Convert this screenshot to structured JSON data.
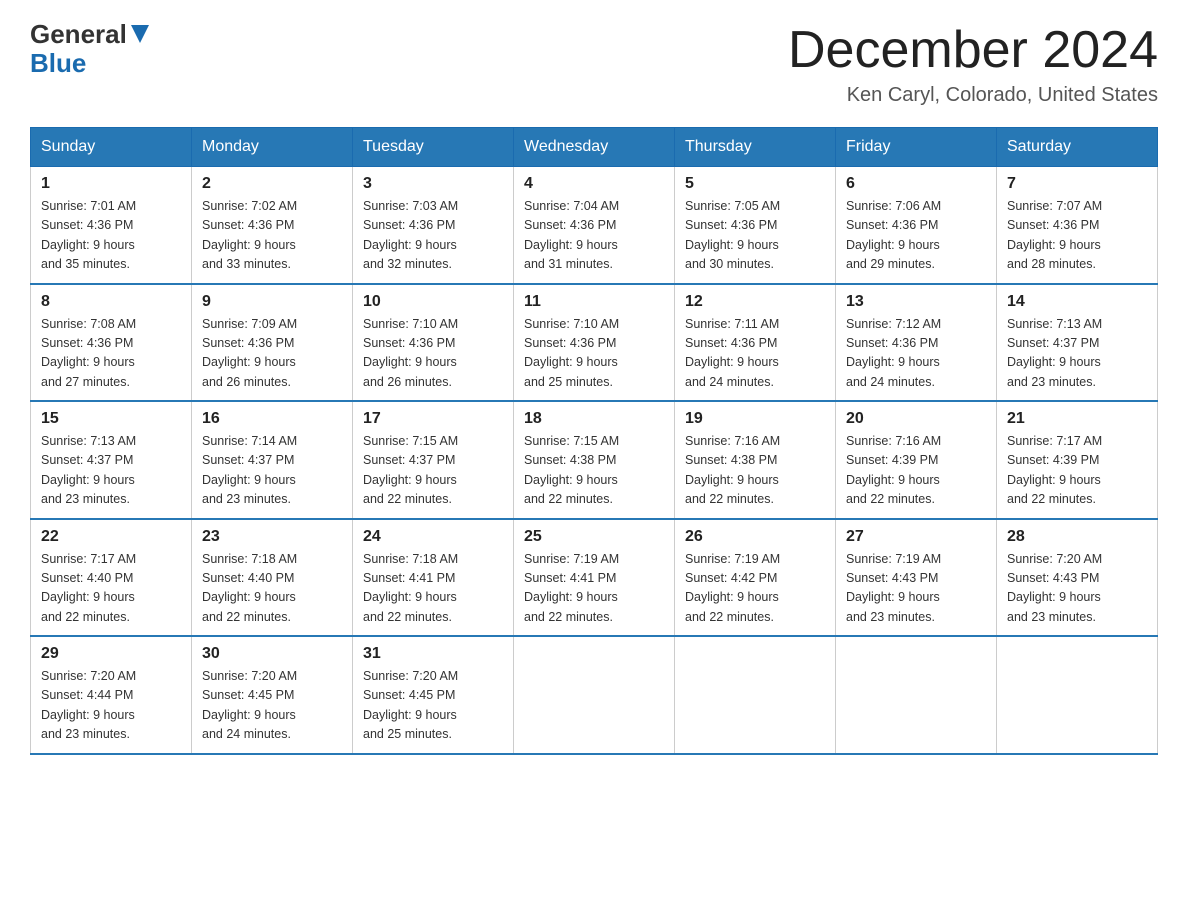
{
  "logo": {
    "line1": "General",
    "line2": "Blue"
  },
  "title": "December 2024",
  "location": "Ken Caryl, Colorado, United States",
  "days_of_week": [
    "Sunday",
    "Monday",
    "Tuesday",
    "Wednesday",
    "Thursday",
    "Friday",
    "Saturday"
  ],
  "weeks": [
    [
      {
        "day": "1",
        "sunrise": "7:01 AM",
        "sunset": "4:36 PM",
        "daylight": "9 hours and 35 minutes."
      },
      {
        "day": "2",
        "sunrise": "7:02 AM",
        "sunset": "4:36 PM",
        "daylight": "9 hours and 33 minutes."
      },
      {
        "day": "3",
        "sunrise": "7:03 AM",
        "sunset": "4:36 PM",
        "daylight": "9 hours and 32 minutes."
      },
      {
        "day": "4",
        "sunrise": "7:04 AM",
        "sunset": "4:36 PM",
        "daylight": "9 hours and 31 minutes."
      },
      {
        "day": "5",
        "sunrise": "7:05 AM",
        "sunset": "4:36 PM",
        "daylight": "9 hours and 30 minutes."
      },
      {
        "day": "6",
        "sunrise": "7:06 AM",
        "sunset": "4:36 PM",
        "daylight": "9 hours and 29 minutes."
      },
      {
        "day": "7",
        "sunrise": "7:07 AM",
        "sunset": "4:36 PM",
        "daylight": "9 hours and 28 minutes."
      }
    ],
    [
      {
        "day": "8",
        "sunrise": "7:08 AM",
        "sunset": "4:36 PM",
        "daylight": "9 hours and 27 minutes."
      },
      {
        "day": "9",
        "sunrise": "7:09 AM",
        "sunset": "4:36 PM",
        "daylight": "9 hours and 26 minutes."
      },
      {
        "day": "10",
        "sunrise": "7:10 AM",
        "sunset": "4:36 PM",
        "daylight": "9 hours and 26 minutes."
      },
      {
        "day": "11",
        "sunrise": "7:10 AM",
        "sunset": "4:36 PM",
        "daylight": "9 hours and 25 minutes."
      },
      {
        "day": "12",
        "sunrise": "7:11 AM",
        "sunset": "4:36 PM",
        "daylight": "9 hours and 24 minutes."
      },
      {
        "day": "13",
        "sunrise": "7:12 AM",
        "sunset": "4:36 PM",
        "daylight": "9 hours and 24 minutes."
      },
      {
        "day": "14",
        "sunrise": "7:13 AM",
        "sunset": "4:37 PM",
        "daylight": "9 hours and 23 minutes."
      }
    ],
    [
      {
        "day": "15",
        "sunrise": "7:13 AM",
        "sunset": "4:37 PM",
        "daylight": "9 hours and 23 minutes."
      },
      {
        "day": "16",
        "sunrise": "7:14 AM",
        "sunset": "4:37 PM",
        "daylight": "9 hours and 23 minutes."
      },
      {
        "day": "17",
        "sunrise": "7:15 AM",
        "sunset": "4:37 PM",
        "daylight": "9 hours and 22 minutes."
      },
      {
        "day": "18",
        "sunrise": "7:15 AM",
        "sunset": "4:38 PM",
        "daylight": "9 hours and 22 minutes."
      },
      {
        "day": "19",
        "sunrise": "7:16 AM",
        "sunset": "4:38 PM",
        "daylight": "9 hours and 22 minutes."
      },
      {
        "day": "20",
        "sunrise": "7:16 AM",
        "sunset": "4:39 PM",
        "daylight": "9 hours and 22 minutes."
      },
      {
        "day": "21",
        "sunrise": "7:17 AM",
        "sunset": "4:39 PM",
        "daylight": "9 hours and 22 minutes."
      }
    ],
    [
      {
        "day": "22",
        "sunrise": "7:17 AM",
        "sunset": "4:40 PM",
        "daylight": "9 hours and 22 minutes."
      },
      {
        "day": "23",
        "sunrise": "7:18 AM",
        "sunset": "4:40 PM",
        "daylight": "9 hours and 22 minutes."
      },
      {
        "day": "24",
        "sunrise": "7:18 AM",
        "sunset": "4:41 PM",
        "daylight": "9 hours and 22 minutes."
      },
      {
        "day": "25",
        "sunrise": "7:19 AM",
        "sunset": "4:41 PM",
        "daylight": "9 hours and 22 minutes."
      },
      {
        "day": "26",
        "sunrise": "7:19 AM",
        "sunset": "4:42 PM",
        "daylight": "9 hours and 22 minutes."
      },
      {
        "day": "27",
        "sunrise": "7:19 AM",
        "sunset": "4:43 PM",
        "daylight": "9 hours and 23 minutes."
      },
      {
        "day": "28",
        "sunrise": "7:20 AM",
        "sunset": "4:43 PM",
        "daylight": "9 hours and 23 minutes."
      }
    ],
    [
      {
        "day": "29",
        "sunrise": "7:20 AM",
        "sunset": "4:44 PM",
        "daylight": "9 hours and 23 minutes."
      },
      {
        "day": "30",
        "sunrise": "7:20 AM",
        "sunset": "4:45 PM",
        "daylight": "9 hours and 24 minutes."
      },
      {
        "day": "31",
        "sunrise": "7:20 AM",
        "sunset": "4:45 PM",
        "daylight": "9 hours and 25 minutes."
      },
      null,
      null,
      null,
      null
    ]
  ],
  "labels": {
    "sunrise": "Sunrise:",
    "sunset": "Sunset:",
    "daylight": "Daylight:"
  }
}
